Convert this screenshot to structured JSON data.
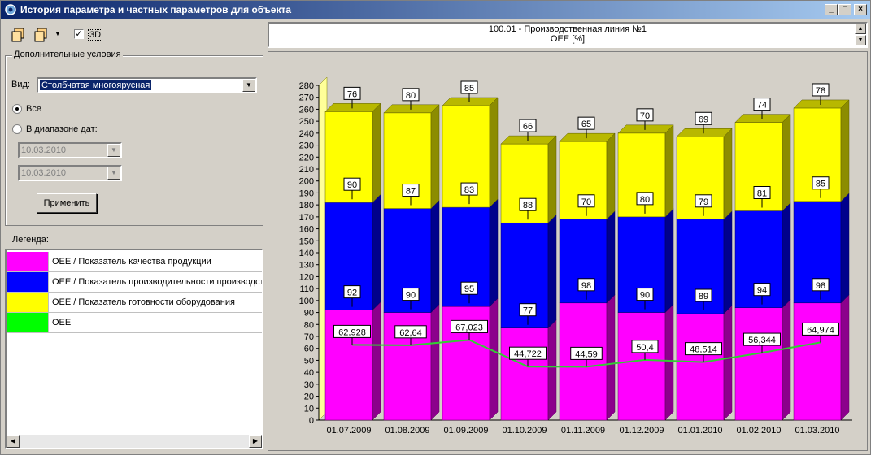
{
  "window": {
    "title": "История параметра и частных параметров для объекта"
  },
  "titlebar_buttons": {
    "minimize": "_",
    "maximize": "□",
    "close": "×"
  },
  "toolbar": {
    "checkbox_3d_label": "3D",
    "checkbox_3d_checked": true
  },
  "conditions": {
    "group_title": "Дополнительные условия",
    "view_label": "Вид:",
    "view_value": "Столбчатая многоярусная",
    "radio_all_label": "Все",
    "radio_range_label": "В диапазоне дат:",
    "date_from": "10.03.2010",
    "date_to": "10.03.2010",
    "apply_label": "Применить"
  },
  "legend": {
    "title": "Легенда:",
    "items": [
      {
        "label": "OEE / Показатель качества продукции",
        "color": "#ff00ff"
      },
      {
        "label": "OEE / Показатель производительности производст",
        "color": "#0000ff"
      },
      {
        "label": "OEE / Показатель готовности оборудования",
        "color": "#ffff00"
      },
      {
        "label": "OEE",
        "color": "#00ff00"
      }
    ]
  },
  "header": {
    "line1": "100.01 - Производственная линия №1",
    "line2": "OEE [%]"
  },
  "chart_data": {
    "type": "bar",
    "stacked": true,
    "three_d": true,
    "categories": [
      "01.07.2009",
      "01.08.2009",
      "01.09.2009",
      "01.10.2009",
      "01.11.2009",
      "01.12.2009",
      "01.01.2010",
      "01.02.2010",
      "01.03.2010"
    ],
    "series": [
      {
        "name": "OEE / Показатель качества продукции",
        "color": "#ff00ff",
        "values": [
          92,
          90,
          95,
          77,
          98,
          90,
          89,
          94,
          98
        ]
      },
      {
        "name": "OEE / Показатель производительности производст",
        "color": "#0000ff",
        "values": [
          90,
          87,
          83,
          88,
          70,
          80,
          79,
          81,
          85
        ]
      },
      {
        "name": "OEE / Показатель готовности оборудования",
        "color": "#ffff00",
        "values": [
          76,
          80,
          85,
          66,
          65,
          70,
          69,
          74,
          78
        ]
      }
    ],
    "line_series": {
      "name": "OEE",
      "color": "#33cc33",
      "values": [
        62.928,
        62.64,
        67.023,
        44.722,
        44.59,
        50.4,
        48.514,
        56.344,
        64.974
      ]
    },
    "line_labels": [
      "62,928",
      "62,64",
      "67,023",
      "44,722",
      "44,59",
      "50,4",
      "48,514",
      "56,344",
      "64,974"
    ],
    "ylim": [
      0,
      280
    ],
    "yticks": [
      0,
      10,
      20,
      30,
      40,
      50,
      60,
      70,
      80,
      90,
      100,
      110,
      120,
      130,
      140,
      150,
      160,
      170,
      180,
      190,
      200,
      210,
      220,
      230,
      240,
      250,
      260,
      270,
      280
    ],
    "grid": false,
    "title": "",
    "xlabel": "",
    "ylabel": ""
  }
}
